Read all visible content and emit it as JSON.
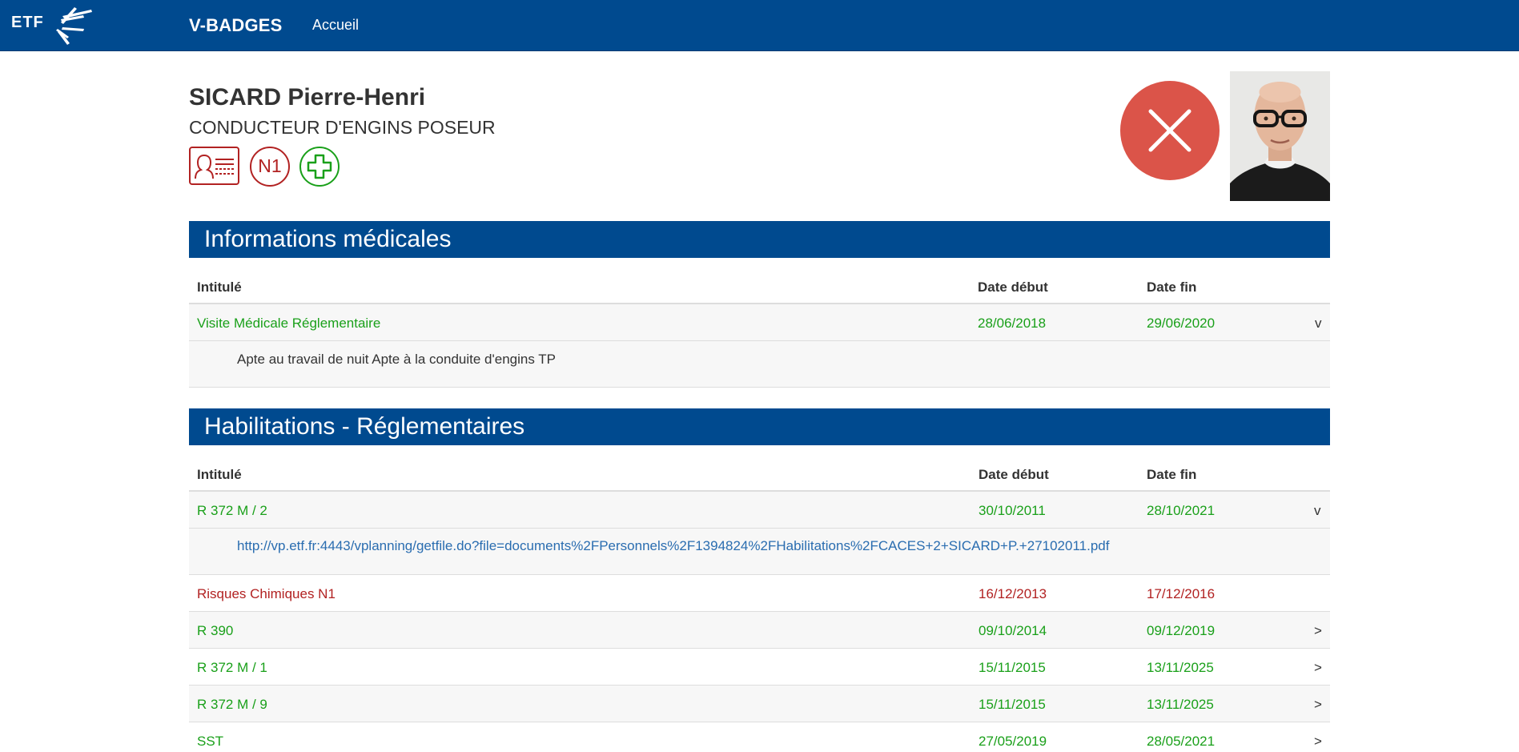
{
  "nav": {
    "brand": "V-BADGES",
    "home": "Accueil",
    "logo_text": "ETF"
  },
  "person": {
    "name": "SICARD Pierre-Henri",
    "role": "CONDUCTEUR D'ENGINS POSEUR",
    "badges": {
      "id_card": "id-card-icon",
      "level": "N1",
      "medical": "medical-cross-icon"
    },
    "status": "close-icon"
  },
  "colors": {
    "primary": "#004a8f",
    "valid": "#1aa01a",
    "expired": "#b22222",
    "status_red": "#db5449",
    "link": "#2a6db0"
  },
  "medical": {
    "title": "Informations médicales",
    "headers": {
      "title": "Intitulé",
      "start": "Date début",
      "end": "Date fin"
    },
    "rows": [
      {
        "label": "Visite Médicale Réglementaire",
        "start": "28/06/2018",
        "end": "29/06/2020",
        "toggle": "v",
        "detail": "Apte au travail de nuit Apte à la conduite d'engins TP"
      }
    ]
  },
  "habilitations": {
    "title": "Habilitations - Réglementaires",
    "headers": {
      "title": "Intitulé",
      "start": "Date début",
      "end": "Date fin"
    },
    "rows": [
      {
        "label": "R 372 M / 2",
        "start": "30/10/2011",
        "end": "28/10/2021",
        "toggle": "v",
        "detail": "http://vp.etf.fr:4443/vplanning/getfile.do?file=documents%2FPersonnels%2F1394824%2FHabilitations%2FCACES+2+SICARD+P.+27102011.pdf"
      },
      {
        "label": "Risques Chimiques N1",
        "start": "16/12/2013",
        "end": "17/12/2016",
        "toggle": ""
      },
      {
        "label": "R 390",
        "start": "09/10/2014",
        "end": "09/12/2019",
        "toggle": ">"
      },
      {
        "label": "R 372 M / 1",
        "start": "15/11/2015",
        "end": "13/11/2025",
        "toggle": ">"
      },
      {
        "label": "R 372 M / 9",
        "start": "15/11/2015",
        "end": "13/11/2025",
        "toggle": ">"
      },
      {
        "label": "SST",
        "start": "27/05/2019",
        "end": "28/05/2021",
        "toggle": ">"
      }
    ]
  }
}
